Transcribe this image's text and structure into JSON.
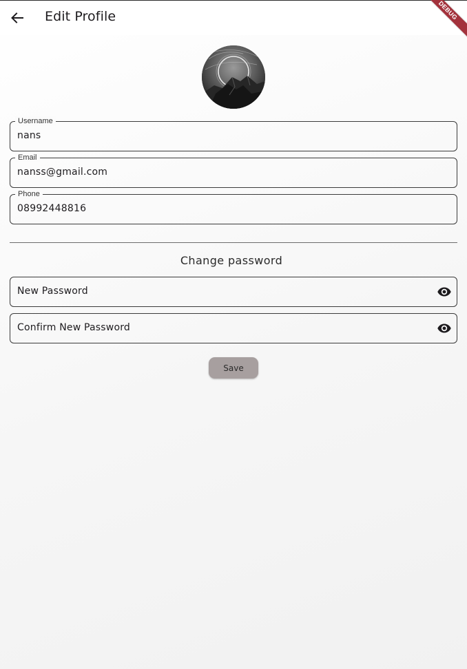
{
  "appbar": {
    "title": "Edit Profile",
    "back_icon": "arrow-left-icon",
    "debug_label": "DEBUG"
  },
  "profile": {
    "avatar_icon": "profile-photo"
  },
  "fields": {
    "username": {
      "label": "Username",
      "value": "nans"
    },
    "email": {
      "label": "Email",
      "value": "nanss@gmail.com"
    },
    "phone": {
      "label": "Phone",
      "value": "08992448816"
    }
  },
  "password_section": {
    "title": "Change password",
    "new_password": {
      "placeholder": "New Password",
      "icon": "eye-icon"
    },
    "confirm_password": {
      "placeholder": "Confirm New Password",
      "icon": "eye-icon"
    }
  },
  "actions": {
    "save_label": "Save"
  },
  "colors": {
    "save_button": "#a79f9f",
    "debug_ribbon": "#a3323c",
    "field_border": "#3a3a3a"
  }
}
